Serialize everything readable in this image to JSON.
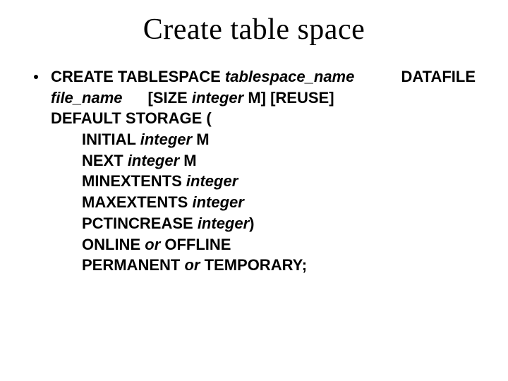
{
  "title": "Create table space",
  "kw": {
    "create_tablespace": "CREATE TABLESPACE",
    "datafile": "DATAFILE",
    "size_open": "[SIZE",
    "size_close": " M] [REUSE]",
    "default_storage": "DEFAULT STORAGE (",
    "initial": "INITIAL",
    "initial_suffix": " M",
    "next": "NEXT",
    "next_suffix": " M",
    "minextents": "MINEXTENTS",
    "maxextents": "MAXEXTENTS",
    "pctincrease": "PCTINCREASE",
    "pct_close": ")",
    "online": "ONLINE",
    "offline": " OFFLINE",
    "permanent": "PERMANENT",
    "temporary": " TEMPORARY;",
    "or1": "or",
    "or2": "or"
  },
  "param": {
    "tablespace_name": "tablespace_name",
    "file_name": "file_name",
    "integer1": "integer",
    "integer2": "integer",
    "integer3": "integer",
    "integer4": "integer",
    "integer5": "integer",
    "integer6": "integer"
  }
}
